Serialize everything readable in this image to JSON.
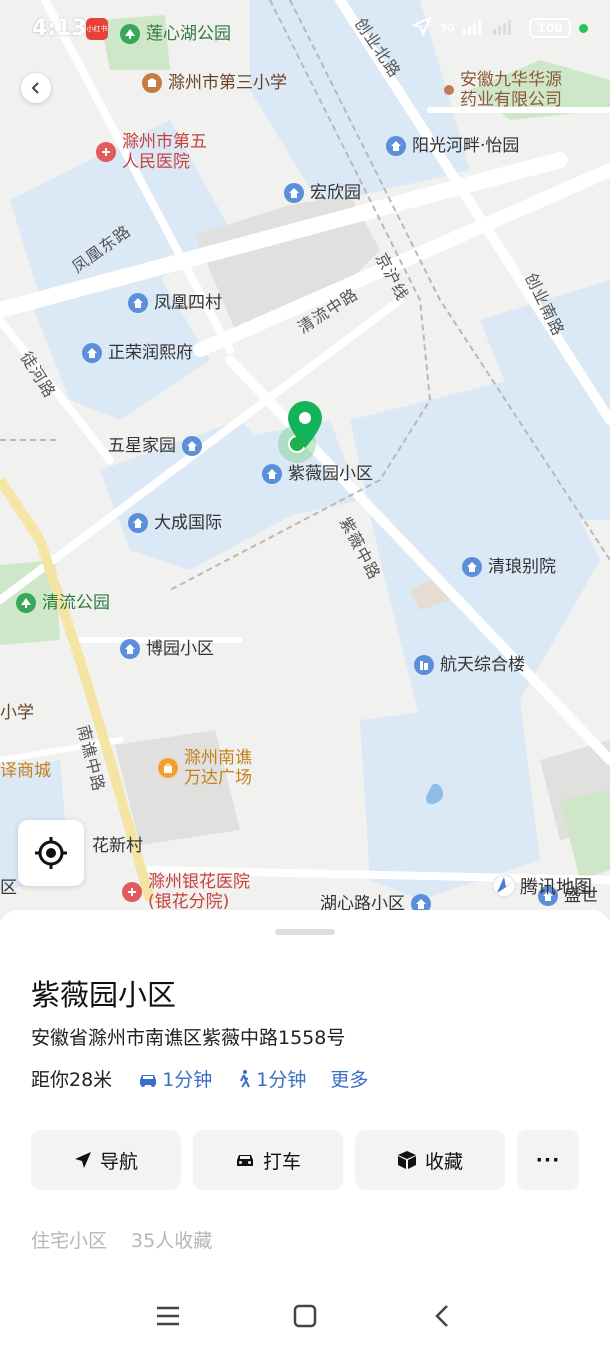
{
  "status_bar": {
    "time": "4:13",
    "app_badge": "小红书",
    "network": "5G",
    "battery": "100"
  },
  "map": {
    "brand": "腾讯地图",
    "pois": {
      "lianxin_park": "莲心湖公园",
      "school3": "滁州市第三小学",
      "pharma": "安徽九华华源\n药业有限公司",
      "hospital5": "滁州市第五\n人民医院",
      "yangguang": "阳光河畔·怡园",
      "hongxin": "宏欣园",
      "fenghuang4": "凤凰四村",
      "zhengrong": "正荣润熙府",
      "wuxing": "五星家园",
      "ziwei": "紫薇园小区",
      "dacheng": "大成国际",
      "qinglang": "清琅别院",
      "qingliu_park": "清流公园",
      "boyuan": "博园小区",
      "hangtian": "航天综合楼",
      "xue": "小学",
      "shangcheng": "译商城",
      "wanda": "滁州南谯\n万达广场",
      "huaxin": "花新村",
      "yinhua": "滁州银花医院\n(银花分院)",
      "huxin": "湖心路小区",
      "yishi": "盛世",
      "qu": "区"
    },
    "roads": {
      "chuangye_n": "创业北路",
      "fenghuang_e": "凤凰东路",
      "qingliu_m": "清流中路",
      "jinghu": "京沪线",
      "chuangye_s": "创业南路",
      "tuhe": "徒河路",
      "ziwei_m": "紫薇中路",
      "nanqiao_m": "南谯中路"
    }
  },
  "sheet": {
    "title": "紫薇园小区",
    "address": "安徽省滁州市南谯区紫薇中路1558号",
    "distance": "距你28米",
    "drive_time": "1分钟",
    "walk_time": "1分钟",
    "more": "更多",
    "actions": {
      "navigate": "导航",
      "taxi": "打车",
      "favorite": "收藏",
      "more": "···"
    },
    "tags": [
      "住宅小区",
      "35人收藏"
    ]
  }
}
